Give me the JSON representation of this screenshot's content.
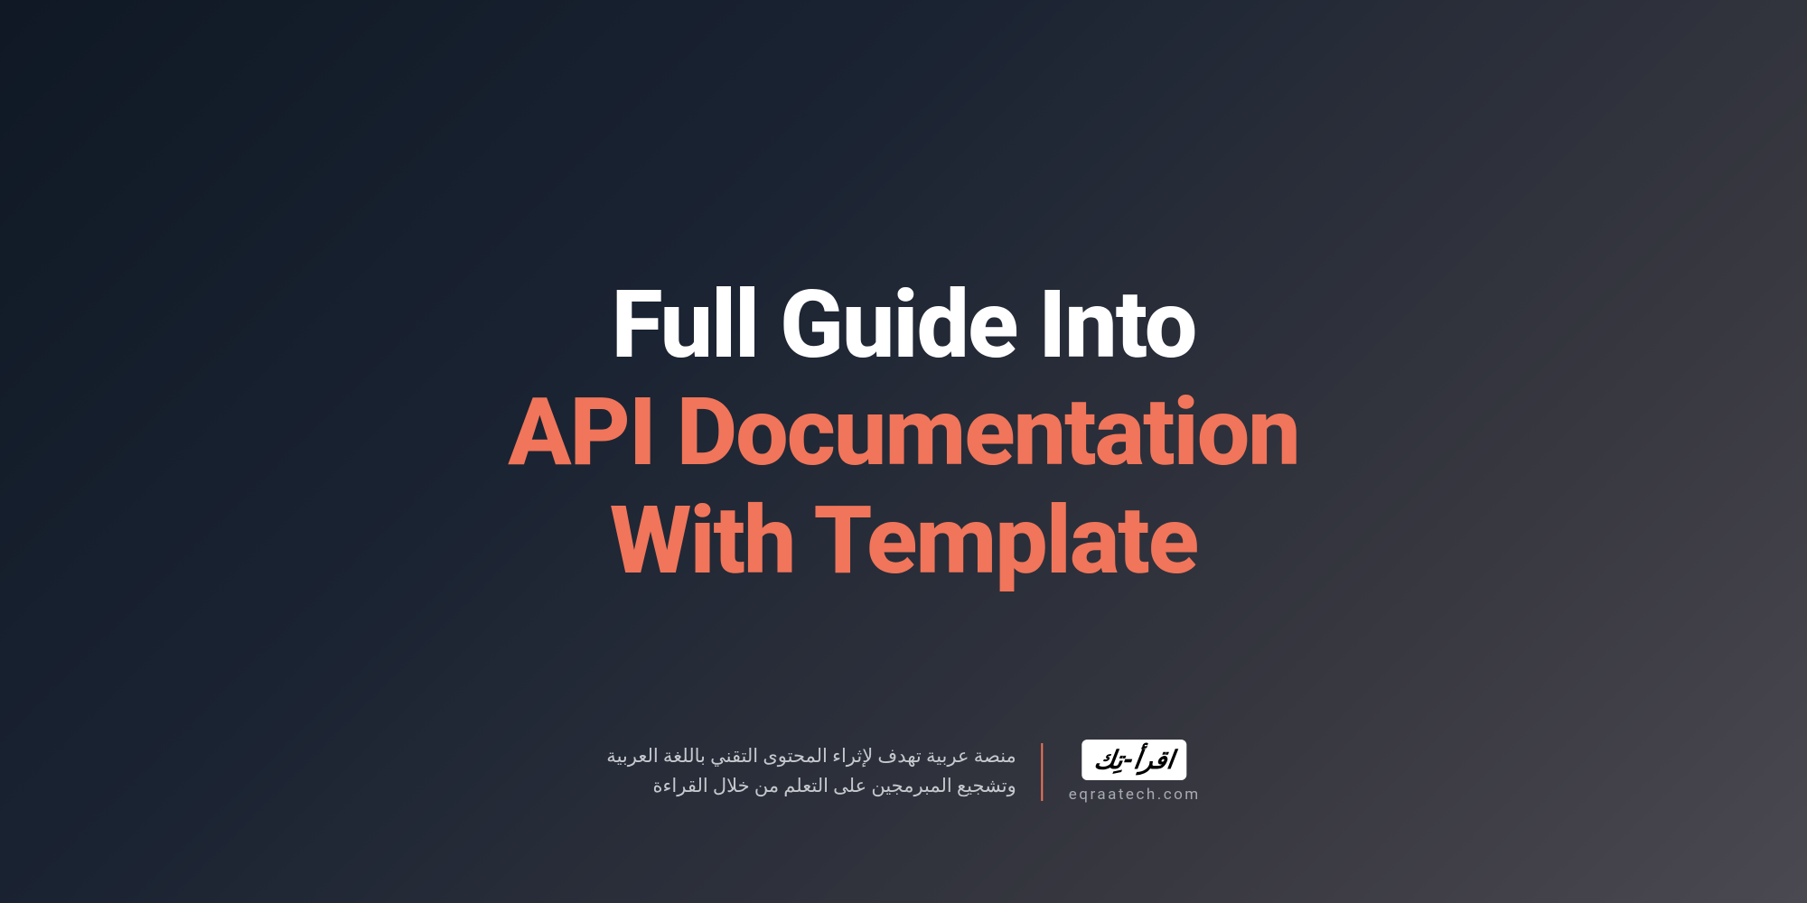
{
  "title": {
    "line1": "Full Guide Into",
    "line2": "API Documentation",
    "line3": "With Template"
  },
  "footer": {
    "arabic_line1": "منصة عربية تهدف لإثراء المحتوى التقني باللغة العربية",
    "arabic_line2": "وتشجيع المبرمجين على التعلم من خلال القراءة",
    "logo_text": "اقرأ-تِك",
    "website": "eqraatech.com"
  }
}
